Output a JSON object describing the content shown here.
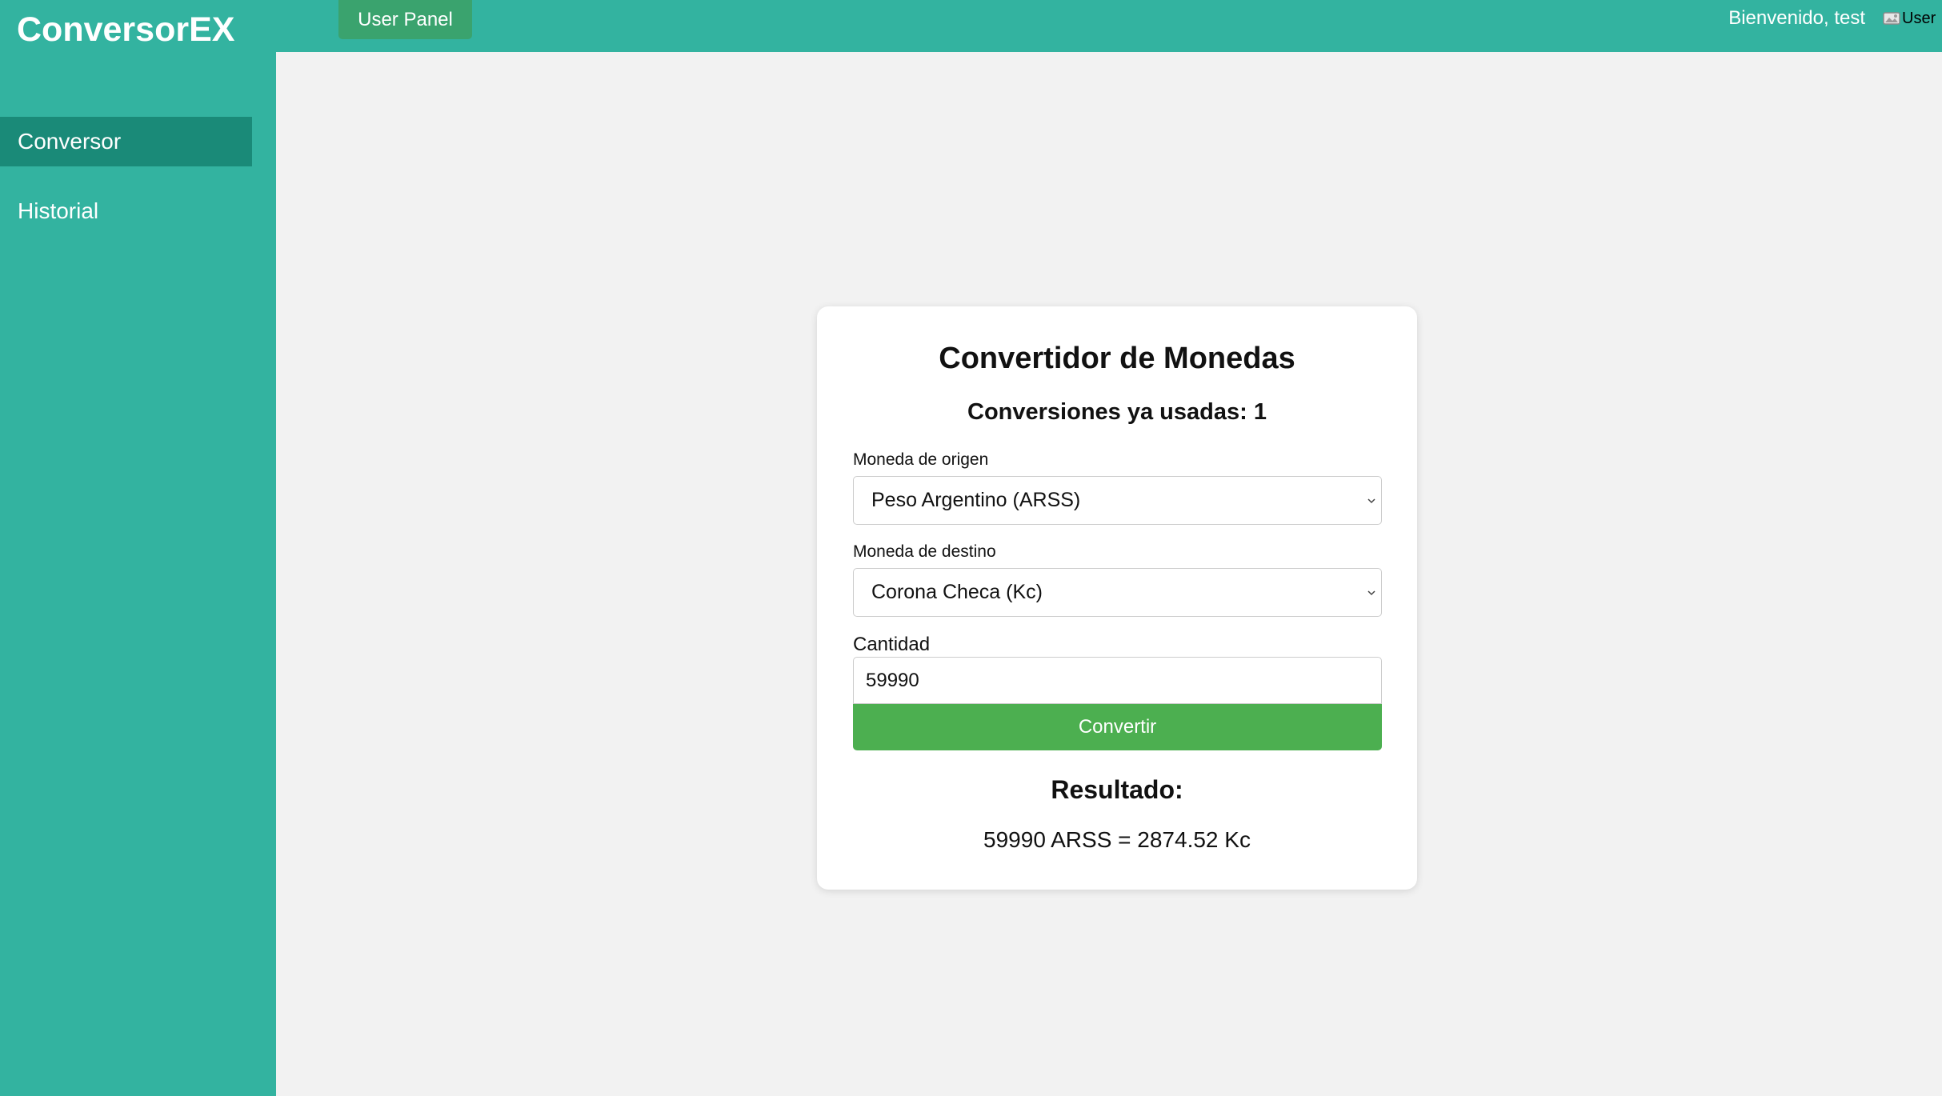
{
  "header": {
    "brand": "ConversorEX",
    "user_panel_label": "User Panel",
    "welcome": "Bienvenido, test",
    "user_avatar_alt": "User"
  },
  "sidebar": {
    "items": [
      {
        "label": "Conversor",
        "active": true
      },
      {
        "label": "Historial",
        "active": false
      }
    ]
  },
  "converter": {
    "title": "Convertidor de Monedas",
    "conversions_used": "Conversiones ya usadas: 1",
    "origin_label": "Moneda de origen",
    "origin_value": "Peso Argentino (ARSS)",
    "destination_label": "Moneda de destino",
    "destination_value": "Corona Checa (Kc)",
    "amount_label": "Cantidad",
    "amount_value": "59990",
    "convert_label": "Convertir",
    "result_title": "Resultado:",
    "result_text": "59990 ARSS = 2874.52 Kc"
  },
  "colors": {
    "primary": "#33b3a0",
    "sidebar_active": "#1a8a78",
    "user_panel_button": "#3aa36e",
    "convert_button": "#4caf50",
    "background": "#f2f2f2"
  }
}
